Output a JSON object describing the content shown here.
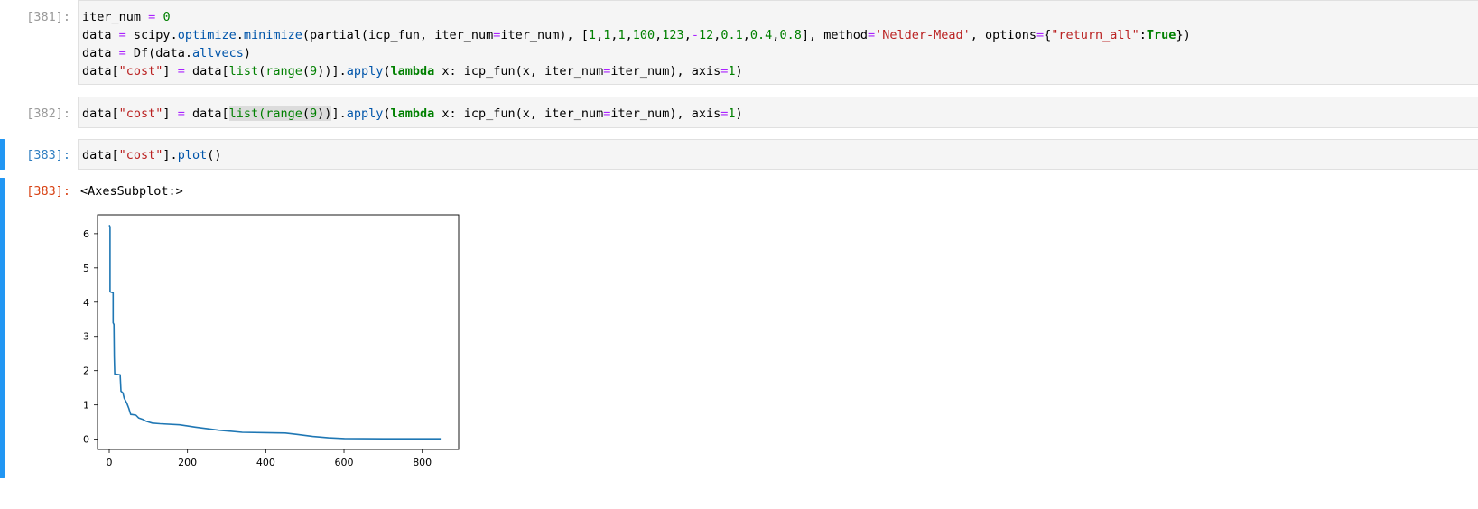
{
  "cells": [
    {
      "prompt": "[381]:",
      "lines": [
        [
          [
            "iter_num",
            "k-var"
          ],
          [
            " ",
            "k-var"
          ],
          [
            "=",
            "k-op"
          ],
          [
            " ",
            "k-var"
          ],
          [
            "0",
            "k-num"
          ]
        ],
        [
          [
            "data",
            "k-var"
          ],
          [
            " ",
            "k-var"
          ],
          [
            "=",
            "k-op"
          ],
          [
            " scipy.",
            "k-var"
          ],
          [
            "optimize",
            "k-attr"
          ],
          [
            ".",
            "k-var"
          ],
          [
            "minimize",
            "k-attr"
          ],
          [
            "(partial(icp_fun, iter_num",
            "k-var"
          ],
          [
            "=",
            "k-op"
          ],
          [
            "iter_num), [",
            "k-var"
          ],
          [
            "1",
            "k-num"
          ],
          [
            ",",
            "k-var"
          ],
          [
            "1",
            "k-num"
          ],
          [
            ",",
            "k-var"
          ],
          [
            "1",
            "k-num"
          ],
          [
            ",",
            "k-var"
          ],
          [
            "100",
            "k-num"
          ],
          [
            ",",
            "k-var"
          ],
          [
            "123",
            "k-num"
          ],
          [
            ",",
            "k-var"
          ],
          [
            "-",
            "k-op"
          ],
          [
            "12",
            "k-num"
          ],
          [
            ",",
            "k-var"
          ],
          [
            "0.1",
            "k-num"
          ],
          [
            ",",
            "k-var"
          ],
          [
            "0.4",
            "k-num"
          ],
          [
            ",",
            "k-var"
          ],
          [
            "0.8",
            "k-num"
          ],
          [
            "], method",
            "k-var"
          ],
          [
            "=",
            "k-op"
          ],
          [
            "'Nelder-Mead'",
            "k-str"
          ],
          [
            ", options",
            "k-var"
          ],
          [
            "=",
            "k-op"
          ],
          [
            "{",
            "k-var"
          ],
          [
            "\"return_all\"",
            "k-str"
          ],
          [
            ":",
            "k-var"
          ],
          [
            "True",
            "k-kw"
          ],
          [
            "})",
            "k-var"
          ]
        ],
        [
          [
            "data",
            "k-var"
          ],
          [
            " ",
            "k-var"
          ],
          [
            "=",
            "k-op"
          ],
          [
            " Df(data.",
            "k-var"
          ],
          [
            "allvecs",
            "k-attr"
          ],
          [
            ")",
            "k-var"
          ]
        ],
        [
          [
            "data[",
            "k-var"
          ],
          [
            "\"cost\"",
            "k-str"
          ],
          [
            "] ",
            "k-var"
          ],
          [
            "=",
            "k-op"
          ],
          [
            " data[",
            "k-var"
          ],
          [
            "list",
            "k-fn"
          ],
          [
            "(",
            "k-var"
          ],
          [
            "range",
            "k-fn"
          ],
          [
            "(",
            "k-var"
          ],
          [
            "9",
            "k-num"
          ],
          [
            "))].",
            "k-var"
          ],
          [
            "apply",
            "k-attr"
          ],
          [
            "(",
            "k-var"
          ],
          [
            "lambda",
            "k-kw"
          ],
          [
            " x: icp_fun(x, iter_num",
            "k-var"
          ],
          [
            "=",
            "k-op"
          ],
          [
            "iter_num), axis",
            "k-var"
          ],
          [
            "=",
            "k-op"
          ],
          [
            "1",
            "k-num"
          ],
          [
            ")",
            "k-var"
          ]
        ]
      ]
    },
    {
      "prompt": "[382]:",
      "lines": [
        [
          [
            "data[",
            "k-var"
          ],
          [
            "\"cost\"",
            "k-str"
          ],
          [
            "] ",
            "k-var"
          ],
          [
            "=",
            "k-op"
          ],
          [
            " data[",
            "k-var"
          ],
          [
            "list(",
            "k-fn hl"
          ],
          [
            "range",
            "k-fn hl"
          ],
          [
            "(",
            "k-var hl"
          ],
          [
            "9",
            "k-num hl"
          ],
          [
            "))",
            "k-var hl"
          ],
          [
            "].",
            "k-var"
          ],
          [
            "apply",
            "k-attr"
          ],
          [
            "(",
            "k-var"
          ],
          [
            "lambda",
            "k-kw"
          ],
          [
            " x: icp_fun(x, iter_num",
            "k-var"
          ],
          [
            "=",
            "k-op"
          ],
          [
            "iter_num), axis",
            "k-var"
          ],
          [
            "=",
            "k-op"
          ],
          [
            "1",
            "k-num"
          ],
          [
            ")",
            "k-var"
          ]
        ]
      ]
    },
    {
      "prompt": "[383]:",
      "lines": [
        [
          [
            "data[",
            "k-var"
          ],
          [
            "\"cost\"",
            "k-str"
          ],
          [
            "].",
            "k-var"
          ],
          [
            "plot",
            "k-attr"
          ],
          [
            "()",
            "k-var"
          ]
        ]
      ]
    }
  ],
  "output": {
    "prompt": "[383]:",
    "text": "<AxesSubplot:>"
  },
  "chart_data": {
    "type": "line",
    "title": "",
    "xlabel": "",
    "ylabel": "",
    "xlim": [
      -30,
      893
    ],
    "ylim": [
      -0.3,
      6.55
    ],
    "xticks": [
      0,
      200,
      400,
      600,
      800
    ],
    "yticks": [
      0,
      1,
      2,
      3,
      4,
      5,
      6
    ],
    "xtick_labels": [
      "0",
      "200",
      "400",
      "600",
      "800"
    ],
    "ytick_labels": [
      "0",
      "1",
      "2",
      "3",
      "4",
      "5",
      "6"
    ],
    "color": "#1f77b4",
    "grid": false,
    "series": [
      {
        "x": [
          0,
          2,
          2,
          10,
          10,
          12,
          13,
          14,
          16,
          28,
          30,
          35,
          38,
          45,
          50,
          55,
          58,
          68,
          75,
          85,
          95,
          110,
          130,
          180,
          220,
          280,
          340,
          400,
          450,
          480,
          520,
          560,
          600,
          700,
          847
        ],
        "y": [
          6.25,
          6.2,
          4.3,
          4.27,
          3.4,
          3.35,
          2.4,
          1.9,
          1.9,
          1.88,
          1.4,
          1.35,
          1.2,
          1.05,
          0.9,
          0.72,
          0.72,
          0.7,
          0.62,
          0.58,
          0.52,
          0.47,
          0.45,
          0.42,
          0.35,
          0.26,
          0.2,
          0.19,
          0.18,
          0.14,
          0.08,
          0.04,
          0.02,
          0.01,
          0.01
        ]
      }
    ]
  }
}
